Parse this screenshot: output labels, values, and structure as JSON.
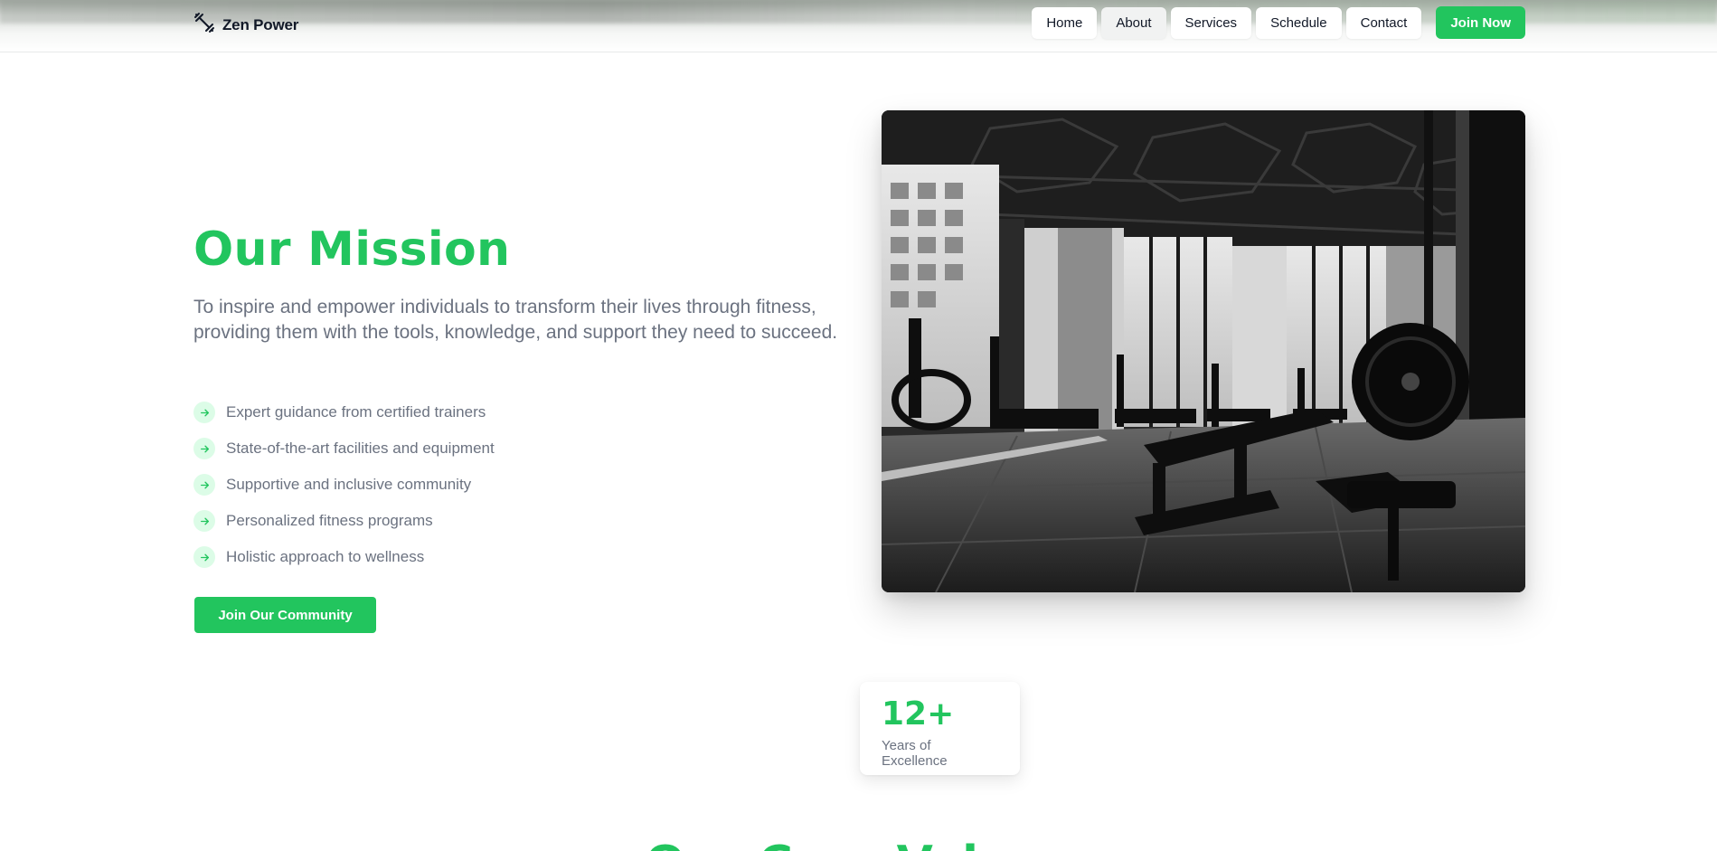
{
  "brand": {
    "name": "Zen Power",
    "logo_icon": "dumbbell-icon"
  },
  "nav": {
    "items": [
      {
        "label": "Home",
        "active": false
      },
      {
        "label": "About",
        "active": true
      },
      {
        "label": "Services",
        "active": false
      },
      {
        "label": "Schedule",
        "active": false
      },
      {
        "label": "Contact",
        "active": false
      }
    ],
    "cta_label": "Join Now"
  },
  "mission": {
    "title": "Our Mission",
    "description": "To inspire and empower individuals to transform their lives through fitness, providing them with the tools, knowledge, and support they need to succeed.",
    "features": [
      "Expert guidance from certified trainers",
      "State-of-the-art facilities and equipment",
      "Supportive and inclusive community",
      "Personalized fitness programs",
      "Holistic approach to wellness"
    ],
    "feature_icon": "arrow-right-icon",
    "cta_label": "Join Our Community"
  },
  "stat": {
    "value": "12+",
    "label": "Years of Excellence"
  },
  "next_section": {
    "title": "Our Core Values"
  },
  "colors": {
    "accent": "#22c55e",
    "accent_light": "#dcfce7",
    "text_muted": "#6b7280",
    "text_dark": "#111827"
  }
}
